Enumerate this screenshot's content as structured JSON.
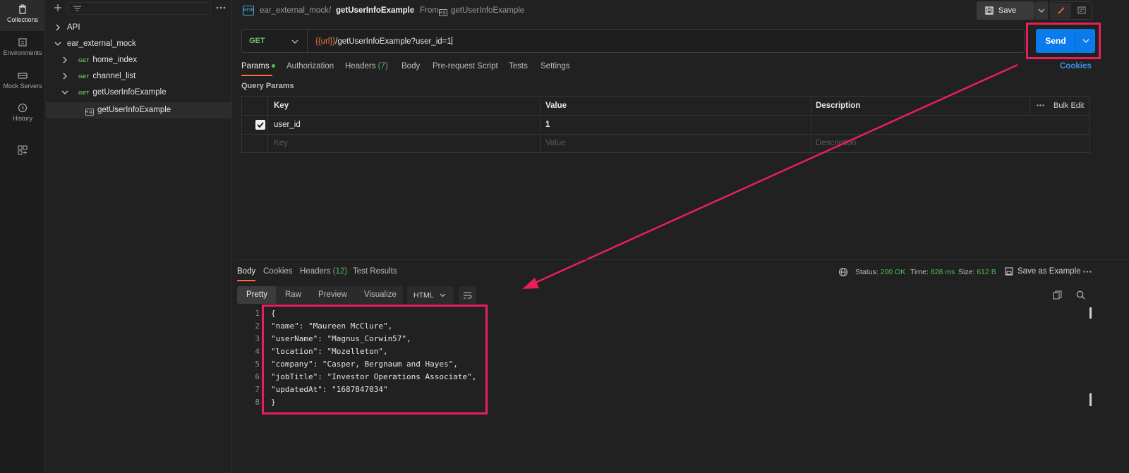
{
  "rail": {
    "items": [
      {
        "label": "Collections",
        "active": true
      },
      {
        "label": "Environments",
        "active": false
      },
      {
        "label": "Mock Servers",
        "active": false
      },
      {
        "label": "History",
        "active": false
      }
    ]
  },
  "sidebar": {
    "tree": [
      {
        "label": "API",
        "method": "",
        "level": 0,
        "expanded": false
      },
      {
        "label": "ear_external_mock",
        "method": "",
        "level": 0,
        "expanded": true
      },
      {
        "label": "home_index",
        "method": "GET",
        "level": 1,
        "expanded": false
      },
      {
        "label": "channel_list",
        "method": "GET",
        "level": 1,
        "expanded": false
      },
      {
        "label": "getUserInfoExample",
        "method": "GET",
        "level": 1,
        "expanded": true
      },
      {
        "label": "getUserInfoExample",
        "method": "example",
        "level": 2,
        "selected": true
      }
    ]
  },
  "header": {
    "collection": "ear_external_mock",
    "separator": "/",
    "request_name": "getUserInfoExample",
    "from_label": "From",
    "from_name": "getUserInfoExample",
    "save_label": "Save",
    "http_badge": "HTTP",
    "example_badge": "e.g."
  },
  "url_bar": {
    "method": "GET",
    "url_var": "{{url}}",
    "url_path": "/getUserInfoExample?user_id=1",
    "send_label": "Send"
  },
  "request_tabs": {
    "params": "Params",
    "authorization": "Authorization",
    "headers": "Headers",
    "headers_count": "(7)",
    "body": "Body",
    "prerequest": "Pre-request Script",
    "tests": "Tests",
    "settings": "Settings",
    "cookies": "Cookies"
  },
  "query_params": {
    "title": "Query Params",
    "columns": {
      "key": "Key",
      "value": "Value",
      "description": "Description"
    },
    "bulk_edit": "Bulk Edit",
    "rows": [
      {
        "checked": true,
        "key": "user_id",
        "value": "1",
        "description": ""
      }
    ],
    "placeholders": {
      "key": "Key",
      "value": "Value",
      "description": "Description"
    }
  },
  "response": {
    "tabs": {
      "body": "Body",
      "cookies": "Cookies",
      "headers": "Headers",
      "headers_count": "(12)",
      "test_results": "Test Results"
    },
    "status_label": "Status:",
    "status_value": "200 OK",
    "time_label": "Time:",
    "time_value": "828 ms",
    "size_label": "Size:",
    "size_value": "612 B",
    "save_example": "Save as Example",
    "format_tabs": {
      "pretty": "Pretty",
      "raw": "Raw",
      "preview": "Preview",
      "visualize": "Visualize"
    },
    "language": "HTML",
    "code_lines": [
      {
        "n": "1",
        "text": "{"
      },
      {
        "n": "2",
        "text": "\"name\": \"Maureen McClure\","
      },
      {
        "n": "3",
        "text": "\"userName\": \"Magnus_Corwin57\","
      },
      {
        "n": "4",
        "text": "\"location\": \"Mozelleton\","
      },
      {
        "n": "5",
        "text": "\"company\": \"Casper, Bergnaum and Hayes\","
      },
      {
        "n": "6",
        "text": "\"jobTitle\": \"Investor Operations Associate\","
      },
      {
        "n": "7",
        "text": "\"updatedAt\": \"1687847034\""
      },
      {
        "n": "8",
        "text": "}"
      }
    ]
  },
  "colors": {
    "accent": "#ff6c37",
    "send_blue": "#097bed",
    "annotation": "#ea1e5a",
    "get_green": "#5fbb67"
  }
}
